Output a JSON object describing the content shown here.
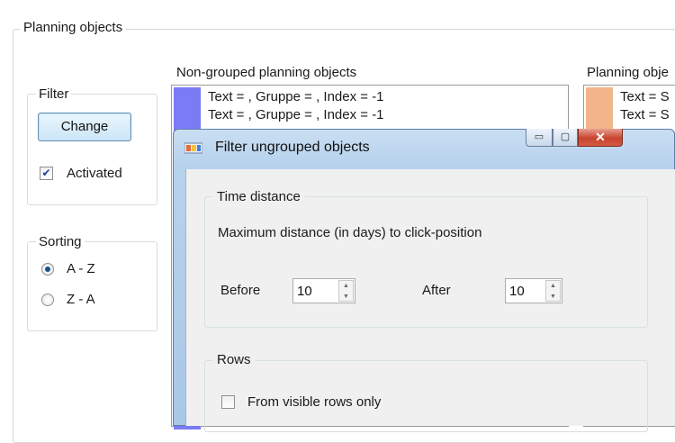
{
  "main_window": {
    "group_title": "Planning objects",
    "filter": {
      "title": "Filter",
      "change_label": "Change",
      "activated_label": "Activated",
      "activated_checked": true
    },
    "sorting": {
      "title": "Sorting",
      "options": [
        "A - Z",
        "Z - A"
      ],
      "selected": "A - Z"
    },
    "nongrouped": {
      "title": "Non-grouped planning objects",
      "rows": [
        "Text = , Gruppe = , Index = -1",
        "Text = , Gruppe = , Index = -1"
      ],
      "swatch_color": "#7a7bf5"
    },
    "planning_list": {
      "title": "Planning obje",
      "rows": [
        "Text = S",
        "Text = S"
      ],
      "swatch_color": "#f2b48a"
    }
  },
  "dialog": {
    "title": "Filter ungrouped objects",
    "window_buttons": {
      "minimize": "▭",
      "maximize": "▢",
      "close": "✕"
    },
    "time_distance": {
      "title": "Time distance",
      "description": "Maximum distance (in days) to click-position",
      "before_label": "Before",
      "before_value": "10",
      "after_label": "After",
      "after_value": "10"
    },
    "rows": {
      "title": "Rows",
      "visible_only_label": "From visible rows only",
      "visible_only_checked": false
    }
  },
  "colors": {
    "close_button": "#c8442f",
    "titlebar": "#b7d2ec",
    "change_button_border": "#6a8fb0"
  }
}
